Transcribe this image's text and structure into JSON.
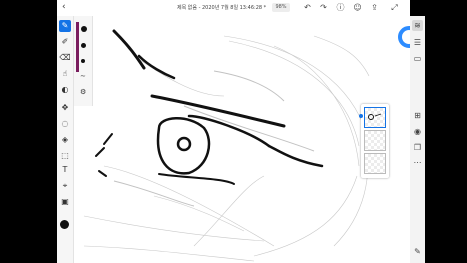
{
  "topbar": {
    "back_icon": "‹",
    "document_title": "제목 없음 - 2020년 7월 8일 13:46:28 *",
    "zoom_label": "98%",
    "icons": [
      "undo-icon",
      "redo-icon",
      "help-icon",
      "share-icon",
      "export-icon",
      "fullscreen-icon"
    ]
  },
  "left_toolbar": {
    "tools": [
      "select",
      "paint-brush",
      "pixel-brush",
      "eraser",
      "smudge",
      "transform",
      "lasso",
      "fill",
      "text",
      "eyedropper",
      "image"
    ],
    "active_tool": "paint-brush",
    "current_color": "#111111"
  },
  "brush_panel": {
    "slider_color": "#7a1d5e"
  },
  "right_rail": {
    "icons": [
      "layers-icon",
      "layer-properties-icon",
      "comments-icon",
      "add-layer-icon",
      "visibility-icon",
      "duplicate-icon",
      "more-icon"
    ],
    "active_icon": "layers-icon"
  },
  "layers": {
    "count": 3,
    "selected_index": 0
  },
  "accent_color": "#1473e6"
}
